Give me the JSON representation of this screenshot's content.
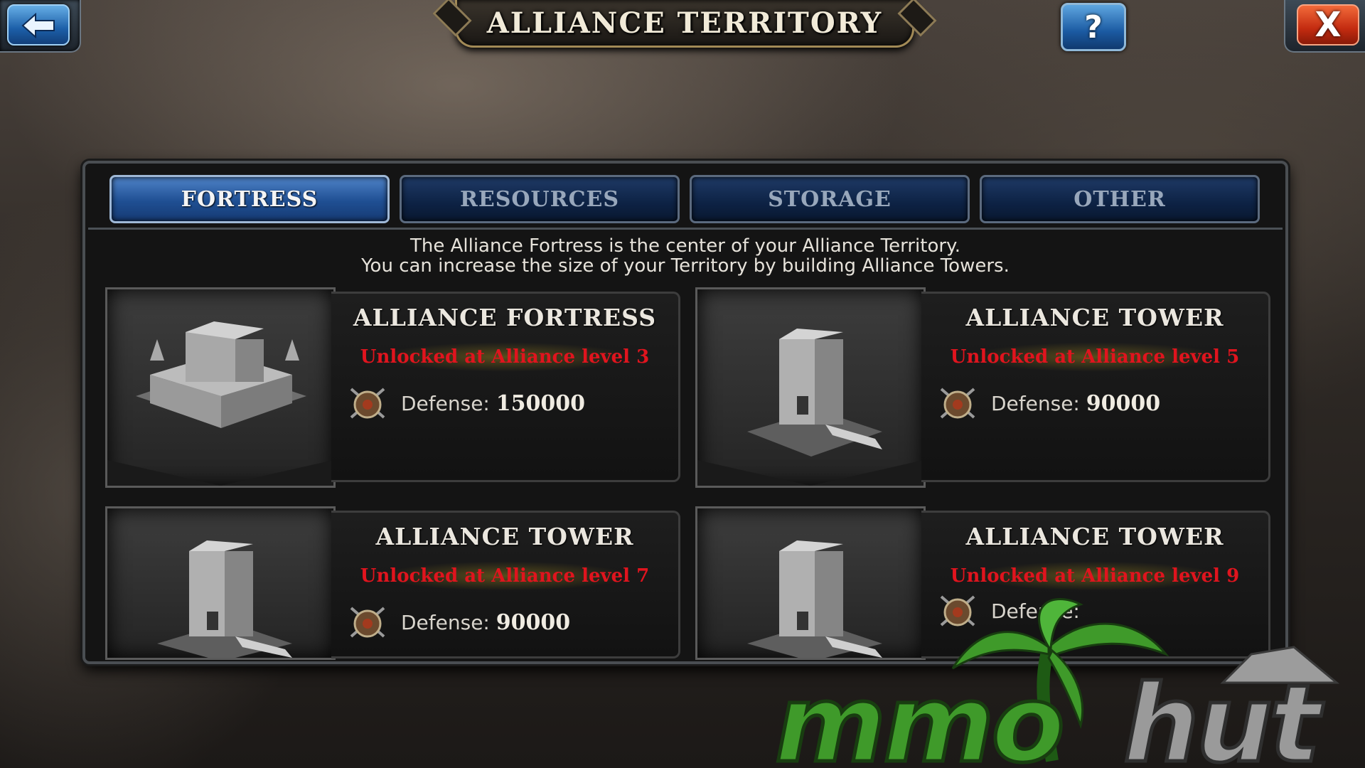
{
  "header": {
    "title": "ALLIANCE TERRITORY",
    "help_label": "?",
    "close_label": "X"
  },
  "tabs": [
    {
      "label": "FORTRESS",
      "active": true
    },
    {
      "label": "RESOURCES",
      "active": false
    },
    {
      "label": "STORAGE",
      "active": false
    },
    {
      "label": "OTHER",
      "active": false
    }
  ],
  "description": {
    "line1": "The Alliance Fortress is the center of your Alliance Territory.",
    "line2": "You can increase the size of your Territory by building Alliance Towers."
  },
  "cards": [
    {
      "name": "ALLIANCE FORTRESS",
      "unlock": "Unlocked at Alliance level 3",
      "defense_label": "Defense:",
      "defense_value": "150000",
      "image": "fortress-image"
    },
    {
      "name": "ALLIANCE TOWER",
      "unlock": "Unlocked at Alliance level 5",
      "defense_label": "Defense:",
      "defense_value": "90000",
      "image": "tower-image"
    },
    {
      "name": "ALLIANCE TOWER",
      "unlock": "Unlocked at Alliance level 7",
      "defense_label": "Defense:",
      "defense_value": "90000",
      "image": "tower-image"
    },
    {
      "name": "ALLIANCE TOWER",
      "unlock": "Unlocked at Alliance level 9",
      "defense_label": "Defense:",
      "defense_value": "",
      "image": "tower-image"
    }
  ],
  "icons": {
    "back": "back-arrow-icon",
    "help": "question-icon",
    "close": "close-icon",
    "defense": "shield-icon"
  },
  "colors": {
    "tab_active": "#2f66b0",
    "tab_inactive": "#0d2244",
    "unlock_text": "#e0141e",
    "watermark_green": "#3f9a2a"
  },
  "watermark": {
    "text": "mmohut"
  }
}
